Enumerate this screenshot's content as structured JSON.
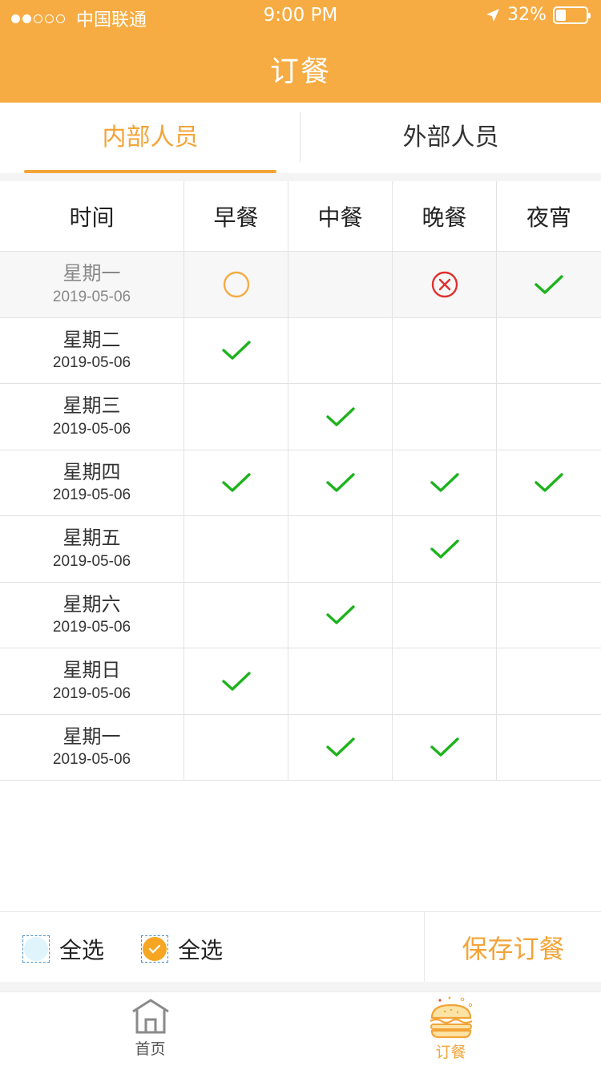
{
  "status": {
    "carrier": "中国联通",
    "time": "9:00 PM",
    "battery": "32%"
  },
  "header": {
    "title": "订餐"
  },
  "tabs": [
    {
      "label": "内部人员",
      "active": true
    },
    {
      "label": "外部人员",
      "active": false
    }
  ],
  "table": {
    "headers": [
      "时间",
      "早餐",
      "中餐",
      "晚餐",
      "夜宵"
    ],
    "rows": [
      {
        "day": "星期一",
        "date": "2019-05-06",
        "meals": [
          "circle",
          "",
          "cross",
          "check"
        ],
        "highlight": true
      },
      {
        "day": "星期二",
        "date": "2019-05-06",
        "meals": [
          "check",
          "",
          "",
          ""
        ]
      },
      {
        "day": "星期三",
        "date": "2019-05-06",
        "meals": [
          "",
          "check",
          "",
          ""
        ]
      },
      {
        "day": "星期四",
        "date": "2019-05-06",
        "meals": [
          "check",
          "check",
          "check",
          "check"
        ]
      },
      {
        "day": "星期五",
        "date": "2019-05-06",
        "meals": [
          "",
          "",
          "check",
          ""
        ]
      },
      {
        "day": "星期六",
        "date": "2019-05-06",
        "meals": [
          "",
          "check",
          "",
          ""
        ]
      },
      {
        "day": "星期日",
        "date": "2019-05-06",
        "meals": [
          "check",
          "",
          "",
          ""
        ]
      },
      {
        "day": "星期一",
        "date": "2019-05-06",
        "meals": [
          "",
          "check",
          "check",
          ""
        ]
      }
    ]
  },
  "footer": {
    "select_all_1": "全选",
    "select_all_2": "全选",
    "save_label": "保存订餐"
  },
  "tabbar": {
    "home_label": "首页",
    "order_label": "订餐"
  },
  "colors": {
    "accent": "#F6AC43",
    "check": "#1DB31D",
    "cross": "#E0302F"
  }
}
